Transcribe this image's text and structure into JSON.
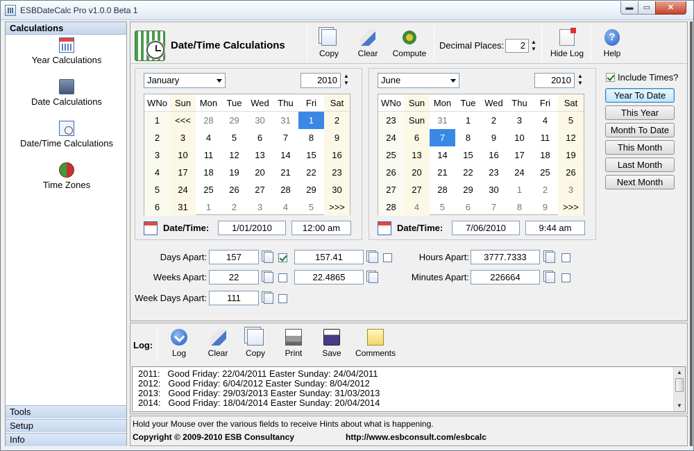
{
  "window": {
    "title": "ESBDateCalc Pro v1.0.0 Beta 1",
    "min_glyph": "▬",
    "max_glyph": "▭",
    "close_glyph": "✕"
  },
  "sidebar": {
    "header": "Calculations",
    "items": [
      {
        "label": "Year Calculations",
        "icon": "calendar-icon"
      },
      {
        "label": "Date Calculations",
        "icon": "date-icon"
      },
      {
        "label": "Date/Time Calculations",
        "icon": "datetime-icon"
      },
      {
        "label": "Time Zones",
        "icon": "globe-icon"
      }
    ],
    "footer": [
      "Tools",
      "Setup",
      "Info"
    ]
  },
  "toolbar": {
    "title": "Date/Time Calculations",
    "copy_label": "Copy",
    "clear_label": "Clear",
    "compute_label": "Compute",
    "decimal_places_label": "Decimal Places:",
    "decimal_places_value": "2",
    "hide_log_label": "Hide Log",
    "help_label": "Help",
    "help_glyph": "?"
  },
  "calendar_headers": [
    "WNo",
    "Sun",
    "Mon",
    "Tue",
    "Wed",
    "Thu",
    "Fri",
    "Sat"
  ],
  "spin_glyphs": {
    "up": "▲",
    "down": "▼"
  },
  "cal1": {
    "month": "January",
    "year": "2010",
    "rows": [
      [
        "1",
        "<<<",
        "28",
        "29",
        "30",
        "31",
        "1",
        "2"
      ],
      [
        "2",
        "3",
        "4",
        "5",
        "6",
        "7",
        "8",
        "9"
      ],
      [
        "3",
        "10",
        "11",
        "12",
        "13",
        "14",
        "15",
        "16"
      ],
      [
        "4",
        "17",
        "18",
        "19",
        "20",
        "21",
        "22",
        "23"
      ],
      [
        "5",
        "24",
        "25",
        "26",
        "27",
        "28",
        "29",
        "30"
      ],
      [
        "6",
        "31",
        "1",
        "2",
        "3",
        "4",
        "5",
        ">>>"
      ]
    ],
    "other_month": [
      [
        0,
        2
      ],
      [
        0,
        3
      ],
      [
        0,
        4
      ],
      [
        0,
        5
      ],
      [
        5,
        2
      ],
      [
        5,
        3
      ],
      [
        5,
        4
      ],
      [
        5,
        5
      ],
      [
        5,
        6
      ]
    ],
    "selected": [
      0,
      6
    ],
    "datetime_label": "Date/Time:",
    "date": "1/01/2010",
    "time": "12:00 am"
  },
  "cal2": {
    "month": "June",
    "year": "2010",
    "rows": [
      [
        "23",
        "Sun",
        "31",
        "1",
        "2",
        "3",
        "4",
        "5"
      ],
      [
        "24",
        "6",
        "7",
        "8",
        "9",
        "10",
        "11",
        "12"
      ],
      [
        "25",
        "13",
        "14",
        "15",
        "16",
        "17",
        "18",
        "19"
      ],
      [
        "26",
        "20",
        "21",
        "22",
        "23",
        "24",
        "25",
        "26"
      ],
      [
        "27",
        "27",
        "28",
        "29",
        "30",
        "1",
        "2",
        "3"
      ],
      [
        "28",
        "4",
        "5",
        "6",
        "7",
        "8",
        "9",
        ">>>"
      ]
    ],
    "other_month": [
      [
        0,
        2
      ],
      [
        4,
        5
      ],
      [
        4,
        6
      ],
      [
        4,
        7
      ],
      [
        5,
        1
      ],
      [
        5,
        2
      ],
      [
        5,
        3
      ],
      [
        5,
        4
      ],
      [
        5,
        5
      ],
      [
        5,
        6
      ]
    ],
    "selected": [
      1,
      2
    ],
    "datetime_label": "Date/Time:",
    "date": "7/06/2010",
    "time": "9:44 am"
  },
  "include_times_label": "Include Times?",
  "quick_buttons": [
    "Year To Date",
    "This Year",
    "Month To Date",
    "This Month",
    "Last Month",
    "Next Month"
  ],
  "apart": {
    "days_label": "Days Apart:",
    "days_value": "157",
    "days_decimal": "157.41",
    "weeks_label": "Weeks Apart:",
    "weeks_value": "22",
    "weeks_decimal": "22.4865",
    "weekdays_label": "Week Days Apart:",
    "weekdays_value": "111",
    "hours_label": "Hours Apart:",
    "hours_value": "3777.7333",
    "minutes_label": "Minutes Apart:",
    "minutes_value": "226664"
  },
  "log": {
    "label": "Log:",
    "buttons": [
      "Log",
      "Clear",
      "Copy",
      "Print",
      "Save",
      "Comments"
    ],
    "lines": [
      "2011:   Good Friday: 22/04/2011 Easter Sunday: 24/04/2011",
      "2012:   Good Friday: 6/04/2012 Easter Sunday: 8/04/2012",
      "2013:   Good Friday: 29/03/2013 Easter Sunday: 31/03/2013",
      "2014:   Good Friday: 18/04/2014 Easter Sunday: 20/04/2014"
    ]
  },
  "status": {
    "hint": "Hold your Mouse over the various fields to receive Hints about what is happening.",
    "copyright": "Copyright © 2009-2010 ESB Consultancy",
    "url": "http://www.esbconsult.com/esbcalc"
  }
}
